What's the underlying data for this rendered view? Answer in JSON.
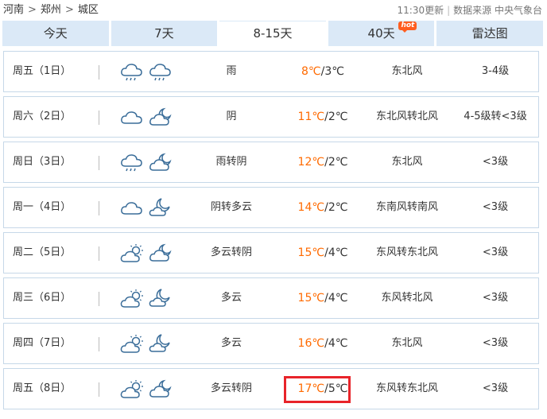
{
  "breadcrumb": {
    "items": [
      "河南",
      "郑州",
      "城区"
    ],
    "separator": ">"
  },
  "update_info": {
    "time": "11:30更新",
    "divider": "|",
    "source": "数据来源 中央气象台"
  },
  "tabs": [
    {
      "label": "今天"
    },
    {
      "label": "7天"
    },
    {
      "label": "8-15天"
    },
    {
      "label": "40天",
      "badge": "hot"
    },
    {
      "label": "雷达图"
    }
  ],
  "active_tab": "8-15天",
  "colors": {
    "tab_bg": "#dbe9f7",
    "high_temp": "#ff6a00",
    "row_border": "#c6d8e8",
    "highlight_box": "#e8242a",
    "hot_badge": "#ff5e1f"
  },
  "forecast": [
    {
      "day": "周五（1日）",
      "icons": [
        "rain-icon",
        "rain-icon"
      ],
      "weather": "雨",
      "high": "8℃",
      "sep": "/",
      "low": "3℃",
      "wind": "东北风",
      "level": "3-4级"
    },
    {
      "day": "周六（2日）",
      "icons": [
        "cloudy-icon",
        "cloudy-night-icon"
      ],
      "weather": "阴",
      "high": "11℃",
      "sep": "/",
      "low": "2℃",
      "wind": "东北风转北风",
      "level": "4-5级转<3级"
    },
    {
      "day": "周日（3日）",
      "icons": [
        "rain-icon",
        "cloudy-night-icon"
      ],
      "weather": "雨转阴",
      "high": "12℃",
      "sep": "/",
      "low": "2℃",
      "wind": "东北风",
      "level": "<3级"
    },
    {
      "day": "周一（4日）",
      "icons": [
        "cloudy-icon",
        "partly-cloudy-night-icon"
      ],
      "weather": "阴转多云",
      "high": "14℃",
      "sep": "/",
      "low": "2℃",
      "wind": "东南风转南风",
      "level": "<3级"
    },
    {
      "day": "周二（5日）",
      "icons": [
        "partly-cloudy-day-icon",
        "cloudy-night-icon"
      ],
      "weather": "多云转阴",
      "high": "15℃",
      "sep": "/",
      "low": "4℃",
      "wind": "东风转东北风",
      "level": "<3级"
    },
    {
      "day": "周三（6日）",
      "icons": [
        "partly-cloudy-day-icon",
        "partly-cloudy-night-icon"
      ],
      "weather": "多云",
      "high": "15℃",
      "sep": "/",
      "low": "4℃",
      "wind": "东风转北风",
      "level": "<3级"
    },
    {
      "day": "周四（7日）",
      "icons": [
        "partly-cloudy-day-icon",
        "partly-cloudy-night-icon"
      ],
      "weather": "多云",
      "high": "16℃",
      "sep": "/",
      "low": "4℃",
      "wind": "东北风",
      "level": "<3级"
    },
    {
      "day": "周五（8日）",
      "icons": [
        "partly-cloudy-day-icon",
        "cloudy-night-icon"
      ],
      "weather": "多云转阴",
      "high": "17℃",
      "sep": "/",
      "low": "5℃",
      "wind": "东风转东北风",
      "level": "<3级",
      "highlighted": true
    }
  ]
}
